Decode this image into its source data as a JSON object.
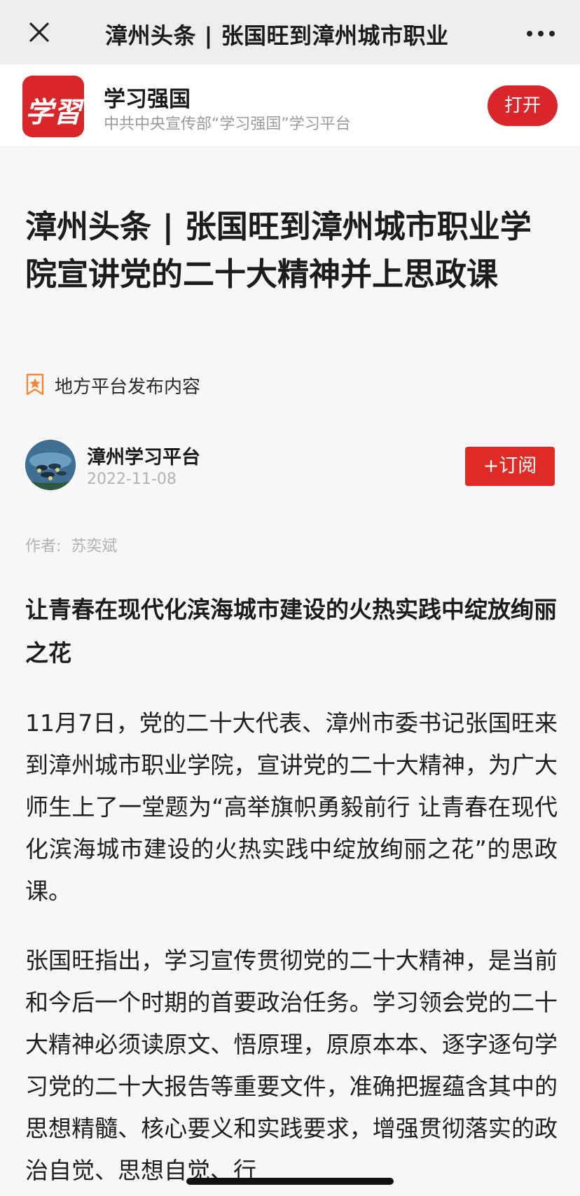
{
  "topbar": {
    "close_icon": "close-icon",
    "title": "漳州头条 | 张国旺到漳州城市职业",
    "more_icon": "more-dots-icon"
  },
  "appbar": {
    "logo_text": "学習",
    "app_name": "学习强国",
    "app_subtitle": "中共中央宣传部“学习强国”学习平台",
    "open_label": "打开",
    "accent_color": "#d9262a"
  },
  "article": {
    "title": "漳州头条 | 张国旺到漳州城市职业学院宣讲党的二十大精神并上思政课",
    "source_tag": "地方平台发布内容",
    "publisher": "漳州学习平台",
    "date": "2022-11-08",
    "subscribe_label": "+订阅",
    "byline_label": "作者:",
    "byline_author": "苏奕斌",
    "subhead": "让青春在现代化滨海城市建设的火热实践中绽放绚丽之花",
    "paragraphs": [
      "11月7日，党的二十大代表、漳州市委书记张国旺来到漳州城市职业学院，宣讲党的二十大精神，为广大师生上了一堂题为“高举旗帜勇毅前行 让青春在现代化滨海城市建设的火热实践中绽放绚丽之花”的思政课。",
      "张国旺指出，学习宣传贯彻党的二十大精神，是当前和今后一个时期的首要政治任务。学习领会党的二十大精神必须读原文、悟原理，原原本本、逐字逐句学习党的二十大报告等重要文件，准确把握蕴含其中的思想精髓、核心要义和实践要求，增强贯彻落实的政治自觉、思想自觉、行"
    ]
  }
}
